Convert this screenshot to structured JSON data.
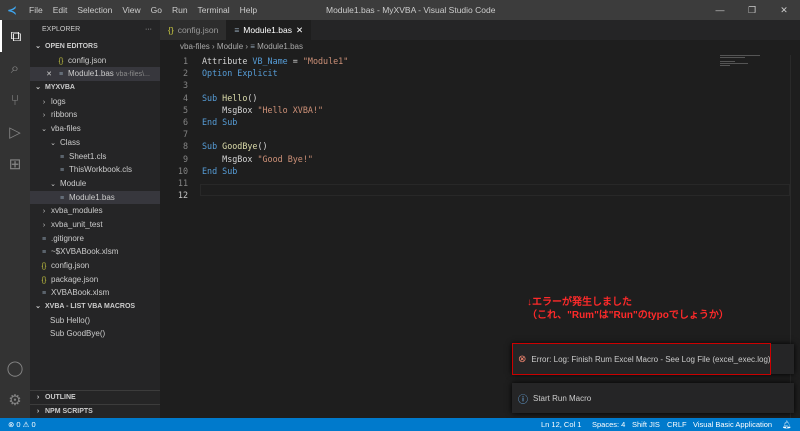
{
  "titlebar": {
    "menu": [
      "File",
      "Edit",
      "Selection",
      "View",
      "Go",
      "Run",
      "Terminal",
      "Help"
    ],
    "title": "Module1.bas - MyXVBA - Visual Studio Code"
  },
  "sidebar": {
    "header": "EXPLORER",
    "more": "···",
    "open_editors": {
      "label": "OPEN EDITORS",
      "items": [
        {
          "name": "config.json"
        },
        {
          "name": "Module1.bas",
          "path": "vba-files\\..."
        }
      ]
    },
    "project": {
      "label": "MYXVBA",
      "items": [
        {
          "name": "logs",
          "indent": 1,
          "kind": "folder"
        },
        {
          "name": "ribbons",
          "indent": 1,
          "kind": "folder"
        },
        {
          "name": "vba-files",
          "indent": 1,
          "kind": "folder-open"
        },
        {
          "name": "Class",
          "indent": 2,
          "kind": "folder-open"
        },
        {
          "name": "Sheet1.cls",
          "indent": 3,
          "kind": "file"
        },
        {
          "name": "ThisWorkbook.cls",
          "indent": 3,
          "kind": "file"
        },
        {
          "name": "Module",
          "indent": 2,
          "kind": "folder-open"
        },
        {
          "name": "Module1.bas",
          "indent": 3,
          "kind": "file",
          "selected": true
        },
        {
          "name": "xvba_modules",
          "indent": 1,
          "kind": "folder"
        },
        {
          "name": "xvba_unit_test",
          "indent": 1,
          "kind": "folder"
        },
        {
          "name": ".gitignore",
          "indent": 1,
          "kind": "file"
        },
        {
          "name": "~$XVBABook.xlsm",
          "indent": 1,
          "kind": "file"
        },
        {
          "name": "config.json",
          "indent": 1,
          "kind": "json"
        },
        {
          "name": "package.json",
          "indent": 1,
          "kind": "json"
        },
        {
          "name": "XVBABook.xlsm",
          "indent": 1,
          "kind": "file"
        }
      ]
    },
    "macros": {
      "label": "XVBA - LIST VBA MACROS",
      "items": [
        "Sub Hello()",
        "Sub GoodBye()"
      ]
    },
    "outline": "OUTLINE",
    "npm": "NPM SCRIPTS"
  },
  "tabs": [
    {
      "label": "config.json"
    },
    {
      "label": "Module1.bas",
      "close": "✕"
    }
  ],
  "breadcrumb": [
    "vba-files",
    "Module",
    "Module1.bas"
  ],
  "code": [
    [
      [
        "",
        "Attribute "
      ],
      [
        "kw",
        "VB_Name"
      ],
      [
        "",
        " = "
      ],
      [
        "st",
        "\"Module1\""
      ]
    ],
    [
      [
        "kw",
        "Option Explicit"
      ]
    ],
    [],
    [
      [
        "kw",
        "Sub "
      ],
      [
        "fn",
        "Hello"
      ],
      [
        "",
        "()"
      ]
    ],
    [
      [
        "",
        "    MsgBox "
      ],
      [
        "st",
        "\"Hello XVBA!\""
      ]
    ],
    [
      [
        "kw",
        "End Sub"
      ]
    ],
    [],
    [
      [
        "kw",
        "Sub "
      ],
      [
        "fn",
        "GoodBye"
      ],
      [
        "",
        "()"
      ]
    ],
    [
      [
        "",
        "    MsgBox "
      ],
      [
        "st",
        "\"Good Bye!\""
      ]
    ],
    [
      [
        "kw",
        "End Sub"
      ]
    ],
    [],
    []
  ],
  "annotation": {
    "line1": "↓エラーが発生しました",
    "line2": "（これ、\"Rum\"は\"Run\"のtypoでしょうか）"
  },
  "notifications": [
    {
      "type": "error",
      "text": "Error: Log: Finish Rum Excel Macro - See Log File (excel_exec.log)"
    },
    {
      "type": "info",
      "text": "Start Run Macro"
    }
  ],
  "status": {
    "errors": "0",
    "warnings": "0",
    "position": "Ln 12, Col 1",
    "spaces": "Spaces: 4",
    "encoding": "Shift JIS",
    "eol": "CRLF",
    "language": "Visual Basic Application"
  }
}
